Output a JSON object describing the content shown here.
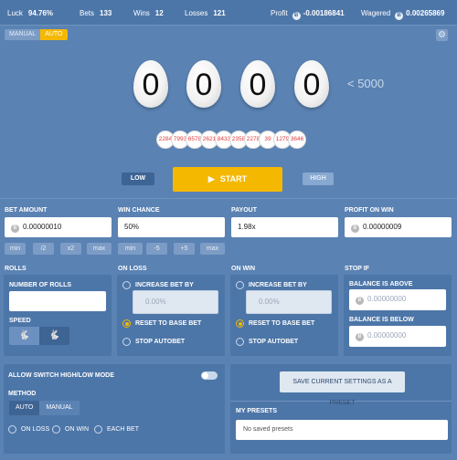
{
  "stats": {
    "luck_label": "Luck",
    "luck_value": "94.76%",
    "bets_label": "Bets",
    "bets_value": "133",
    "wins_label": "Wins",
    "wins_value": "12",
    "losses_label": "Losses",
    "losses_value": "121",
    "profit_label": "Profit",
    "profit_value": "-0.00186841",
    "wagered_label": "Wagered",
    "wagered_value": "0.00265869",
    "coin_glyph": "Ƀ"
  },
  "mode": {
    "manual": "MANUAL",
    "auto": "AUTO",
    "selected": "AUTO"
  },
  "settings_icon": "gear-icon",
  "result": {
    "digits": [
      "0",
      "0",
      "0",
      "0"
    ],
    "target": "< 5000"
  },
  "history": [
    "2284",
    "7993",
    "6578",
    "2621",
    "8433",
    "2358",
    "2278",
    "39",
    "1279",
    "3646"
  ],
  "buttons": {
    "low": "LOW",
    "start": "START",
    "start_icon": "▶",
    "high": "HIGH"
  },
  "bet_amount": {
    "label": "BET AMOUNT",
    "value": "0.00000010",
    "min": "min",
    "half": "/2",
    "double": "x2",
    "max": "max"
  },
  "win_chance": {
    "label": "WIN CHANCE",
    "value": "50%",
    "min": "min",
    "minus": "-5",
    "plus": "+5",
    "max": "max"
  },
  "payout": {
    "label": "PAYOUT",
    "value": "1.98x"
  },
  "profit_on_win": {
    "label": "PROFIT ON WIN",
    "value": "0.00000009"
  },
  "rolls": {
    "section": "ROLLS",
    "number_label": "NUMBER OF ROLLS",
    "number_value": "",
    "speed_label": "SPEED",
    "speed_options": [
      "slow-rabbit-icon",
      "fast-rabbit-icon"
    ],
    "speed_selected": "fast"
  },
  "on_loss": {
    "section": "ON LOSS",
    "increase_label": "INCREASE BET BY",
    "increase_placeholder": "0.00%",
    "reset_label": "RESET TO BASE BET",
    "stop_label": "STOP AUTOBET",
    "selected": "reset"
  },
  "on_win": {
    "section": "ON WIN",
    "increase_label": "INCREASE BET BY",
    "increase_placeholder": "0.00%",
    "reset_label": "RESET TO BASE BET",
    "stop_label": "STOP AUTOBET",
    "selected": "reset"
  },
  "stop_if": {
    "section": "STOP IF",
    "above_label": "BALANCE IS ABOVE",
    "above_placeholder": "0.00000000",
    "below_label": "BALANCE IS BELOW",
    "below_placeholder": "0.00000000"
  },
  "switch": {
    "label": "ALLOW SWITCH HIGH/LOW MODE",
    "enabled": false,
    "method_label": "METHOD",
    "method_auto": "AUTO",
    "method_manual": "MANUAL",
    "on_loss": "ON LOSS",
    "on_win": "ON WIN",
    "each_bet": "EACH BET"
  },
  "presets": {
    "save_button": "SAVE CURRENT SETTINGS AS A PRESET",
    "title": "MY PRESETS",
    "empty": "No saved presets"
  },
  "colors": {
    "accent": "#f5b800",
    "background": "#5a82b3",
    "panel": "#4d76a8",
    "history_text": "#e23a3a"
  }
}
